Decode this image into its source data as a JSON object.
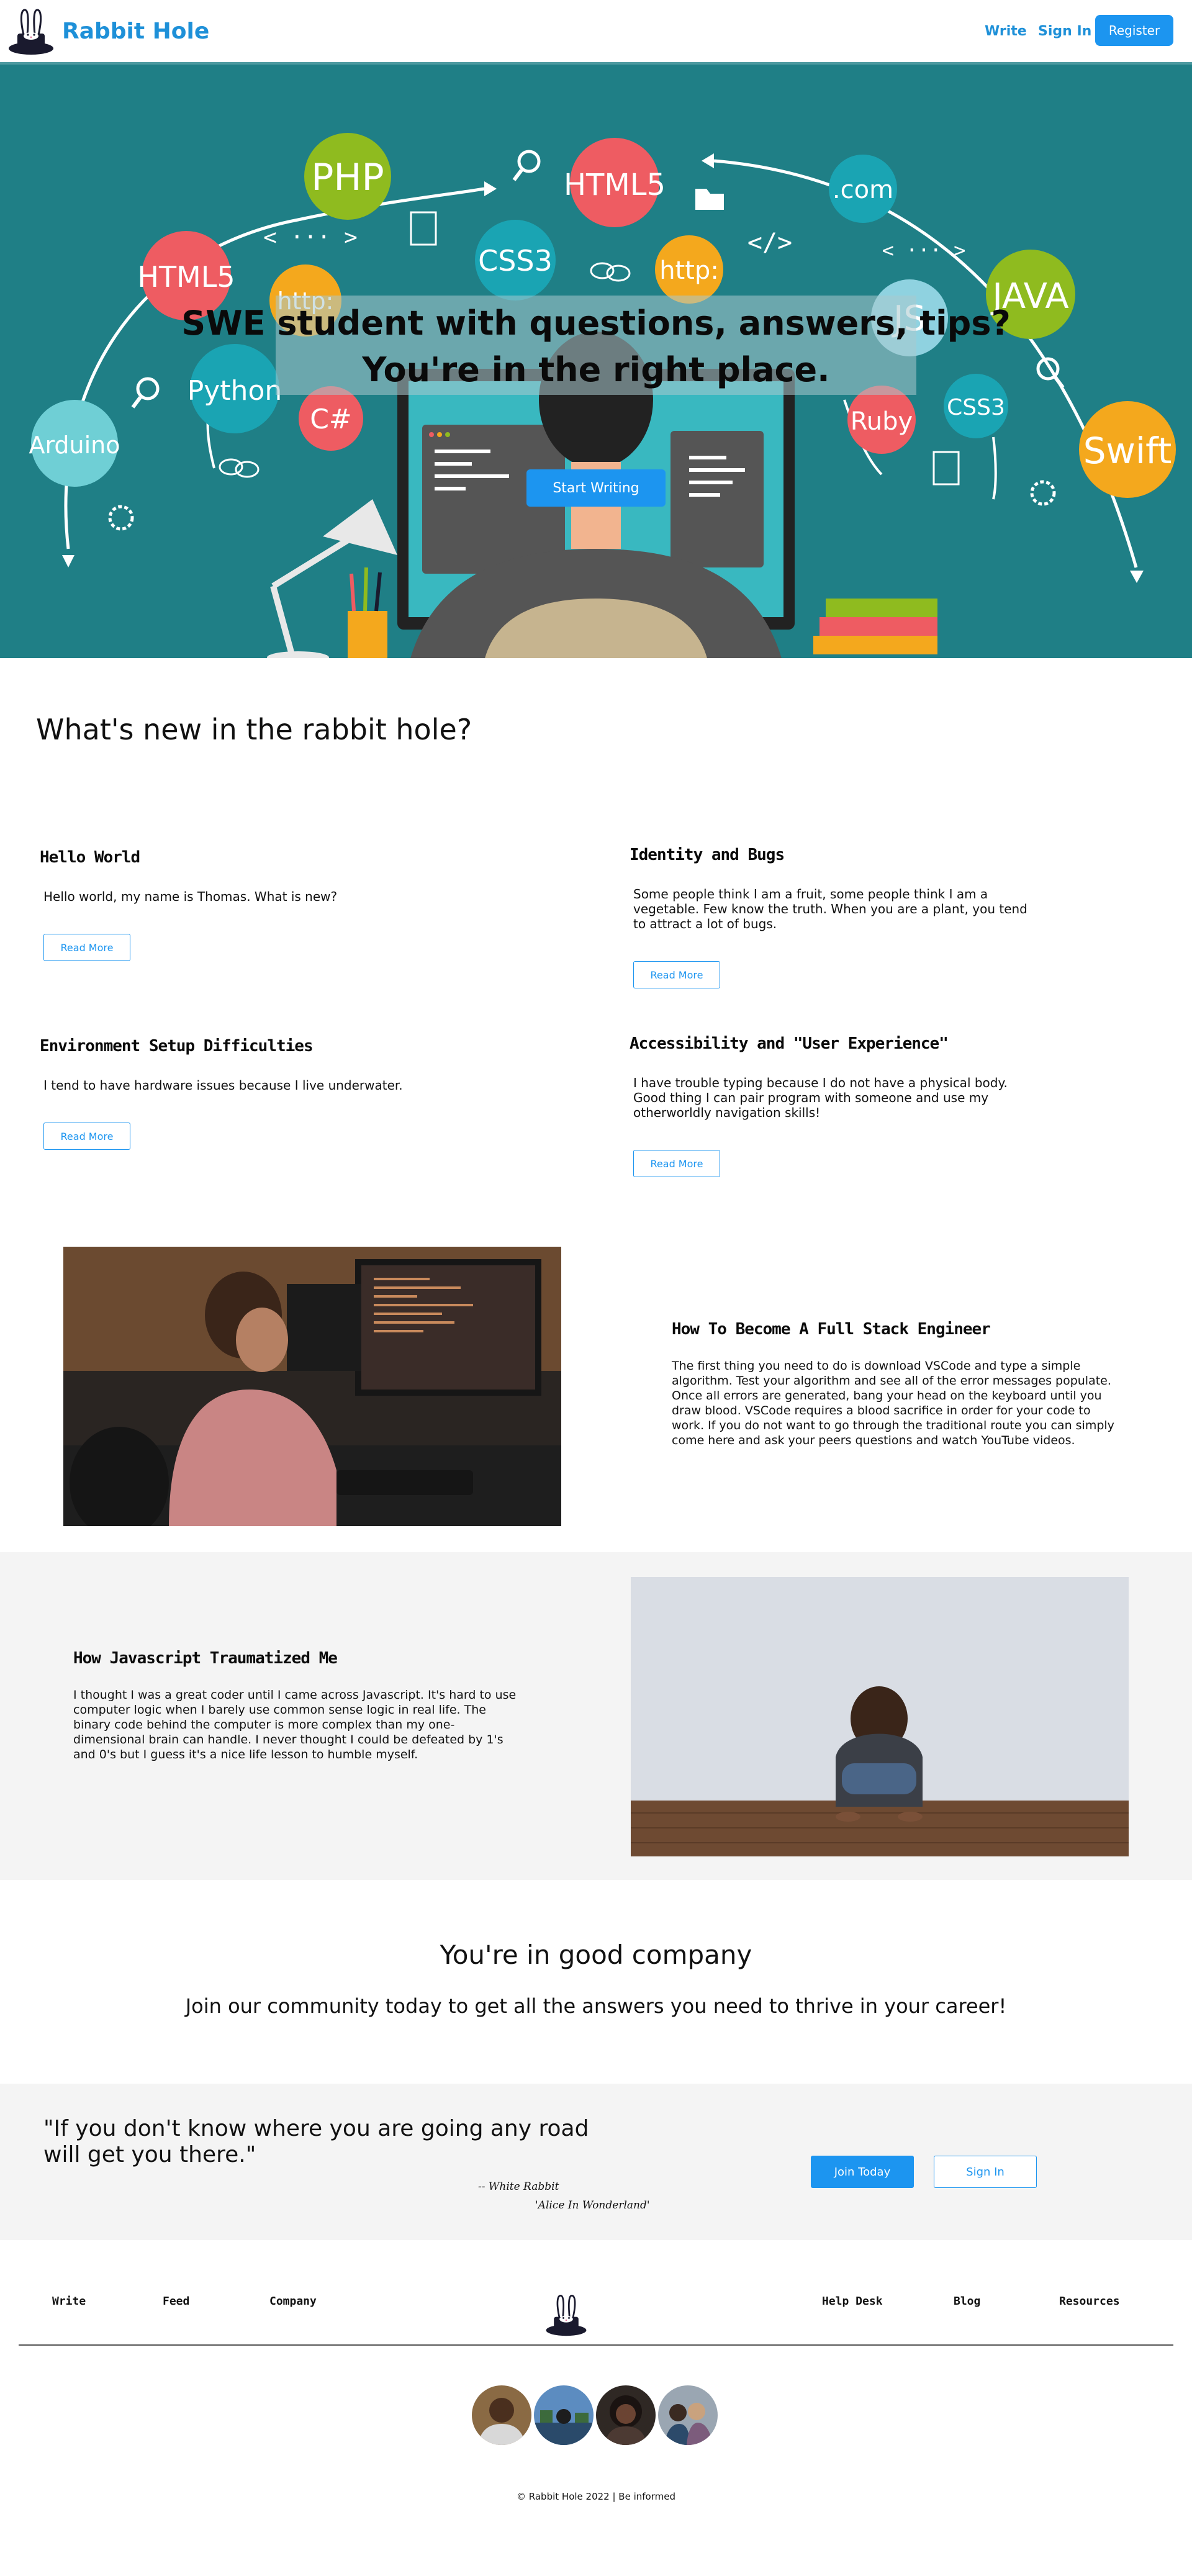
{
  "nav": {
    "brand": "Rabbit Hole",
    "write": "Write",
    "sign_in": "Sign In",
    "register": "Register"
  },
  "hero": {
    "line1": "SWE student with questions, answers, tips?",
    "line2": "You're in the right place.",
    "button": "Start Writing",
    "badges": [
      "PHP",
      "HTML5",
      ".com",
      "HTML5",
      "CSS3",
      "http:",
      "JAVA",
      "http:",
      "JS",
      "Python",
      "C#",
      "Ruby",
      "CSS3",
      "Arduino",
      "Swift"
    ],
    "code_tags": [
      "< ··· >",
      "</>",
      "< ··· >"
    ]
  },
  "whats_new": {
    "heading": "What's new in the rabbit hole?",
    "posts": [
      {
        "title": "Hello World",
        "body": "Hello world, my name is Thomas. What is new?",
        "button": "Read More"
      },
      {
        "title": "Identity and Bugs",
        "body": "Some people think I am a fruit, some people think I am a vegetable. Few know the truth. When you are a plant, you tend to attract a lot of bugs.",
        "button": "Read More"
      },
      {
        "title": "Environment Setup Difficulties",
        "body": "I tend to have hardware issues because I live underwater.",
        "button": "Read More"
      },
      {
        "title": "Accessibility and \"User Experience\"",
        "body": "I have trouble typing because I do not have a physical body. Good thing I can pair program with someone and use my otherworldly navigation skills!",
        "button": "Read More"
      }
    ]
  },
  "features": [
    {
      "title": "How To Become A Full Stack Engineer",
      "body": "The first thing you need to do is download VSCode and type a simple algorithm. Test your algorithm and see all of the error messages populate. Once all errors are generated, bang your head on the keyboard until you draw blood. VSCode requires a blood sacrifice in order for your code to work. If you do not want to go through the traditional route you can simply come here and ask your peers questions and watch YouTube videos."
    },
    {
      "title": "How Javascript Traumatized Me",
      "body": "I thought I was a great coder until I came across Javascript. It's hard to use computer logic when I barely use common sense logic in real life. The binary code behind the computer is more complex than my one-dimensional brain can handle. I never thought I could be defeated by 1's and 0's but I guess it's a nice life lesson to humble myself."
    }
  ],
  "company": {
    "heading": "You're in good company",
    "subheading": "Join our community today to get all the answers you need to thrive in your career!"
  },
  "quote": {
    "text": "\"If you don't know where you are going any road will get you there.\"",
    "author": "-- White Rabbit",
    "source": "'Alice In Wonderland'",
    "join_button": "Join Today",
    "signin_button": "Sign In"
  },
  "footer": {
    "links": [
      "Write",
      "Feed",
      "Company",
      "Help Desk",
      "Blog",
      "Resources"
    ],
    "copyright": "© Rabbit Hole 2022 | Be informed"
  },
  "colors": {
    "accent": "#1c95f0",
    "brand": "#1e90d8",
    "hero_bg": "#1f7f86",
    "band_bg": "#f4f4f4"
  }
}
